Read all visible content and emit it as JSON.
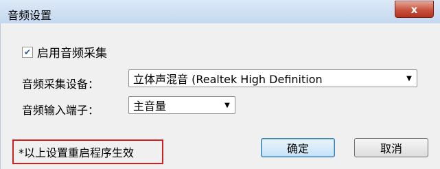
{
  "window": {
    "title": "音频设置",
    "close_label": "x"
  },
  "form": {
    "enable_capture": {
      "label": "启用音频采集",
      "checked": true
    },
    "capture_device": {
      "label": "音频采集设备：",
      "value": "立体声混音 (Realtek High Definition"
    },
    "input_port": {
      "label": "音频输入端子：",
      "value": "主音量"
    }
  },
  "note": "*以上设置重启程序生效",
  "buttons": {
    "ok": "确定",
    "cancel": "取消"
  }
}
